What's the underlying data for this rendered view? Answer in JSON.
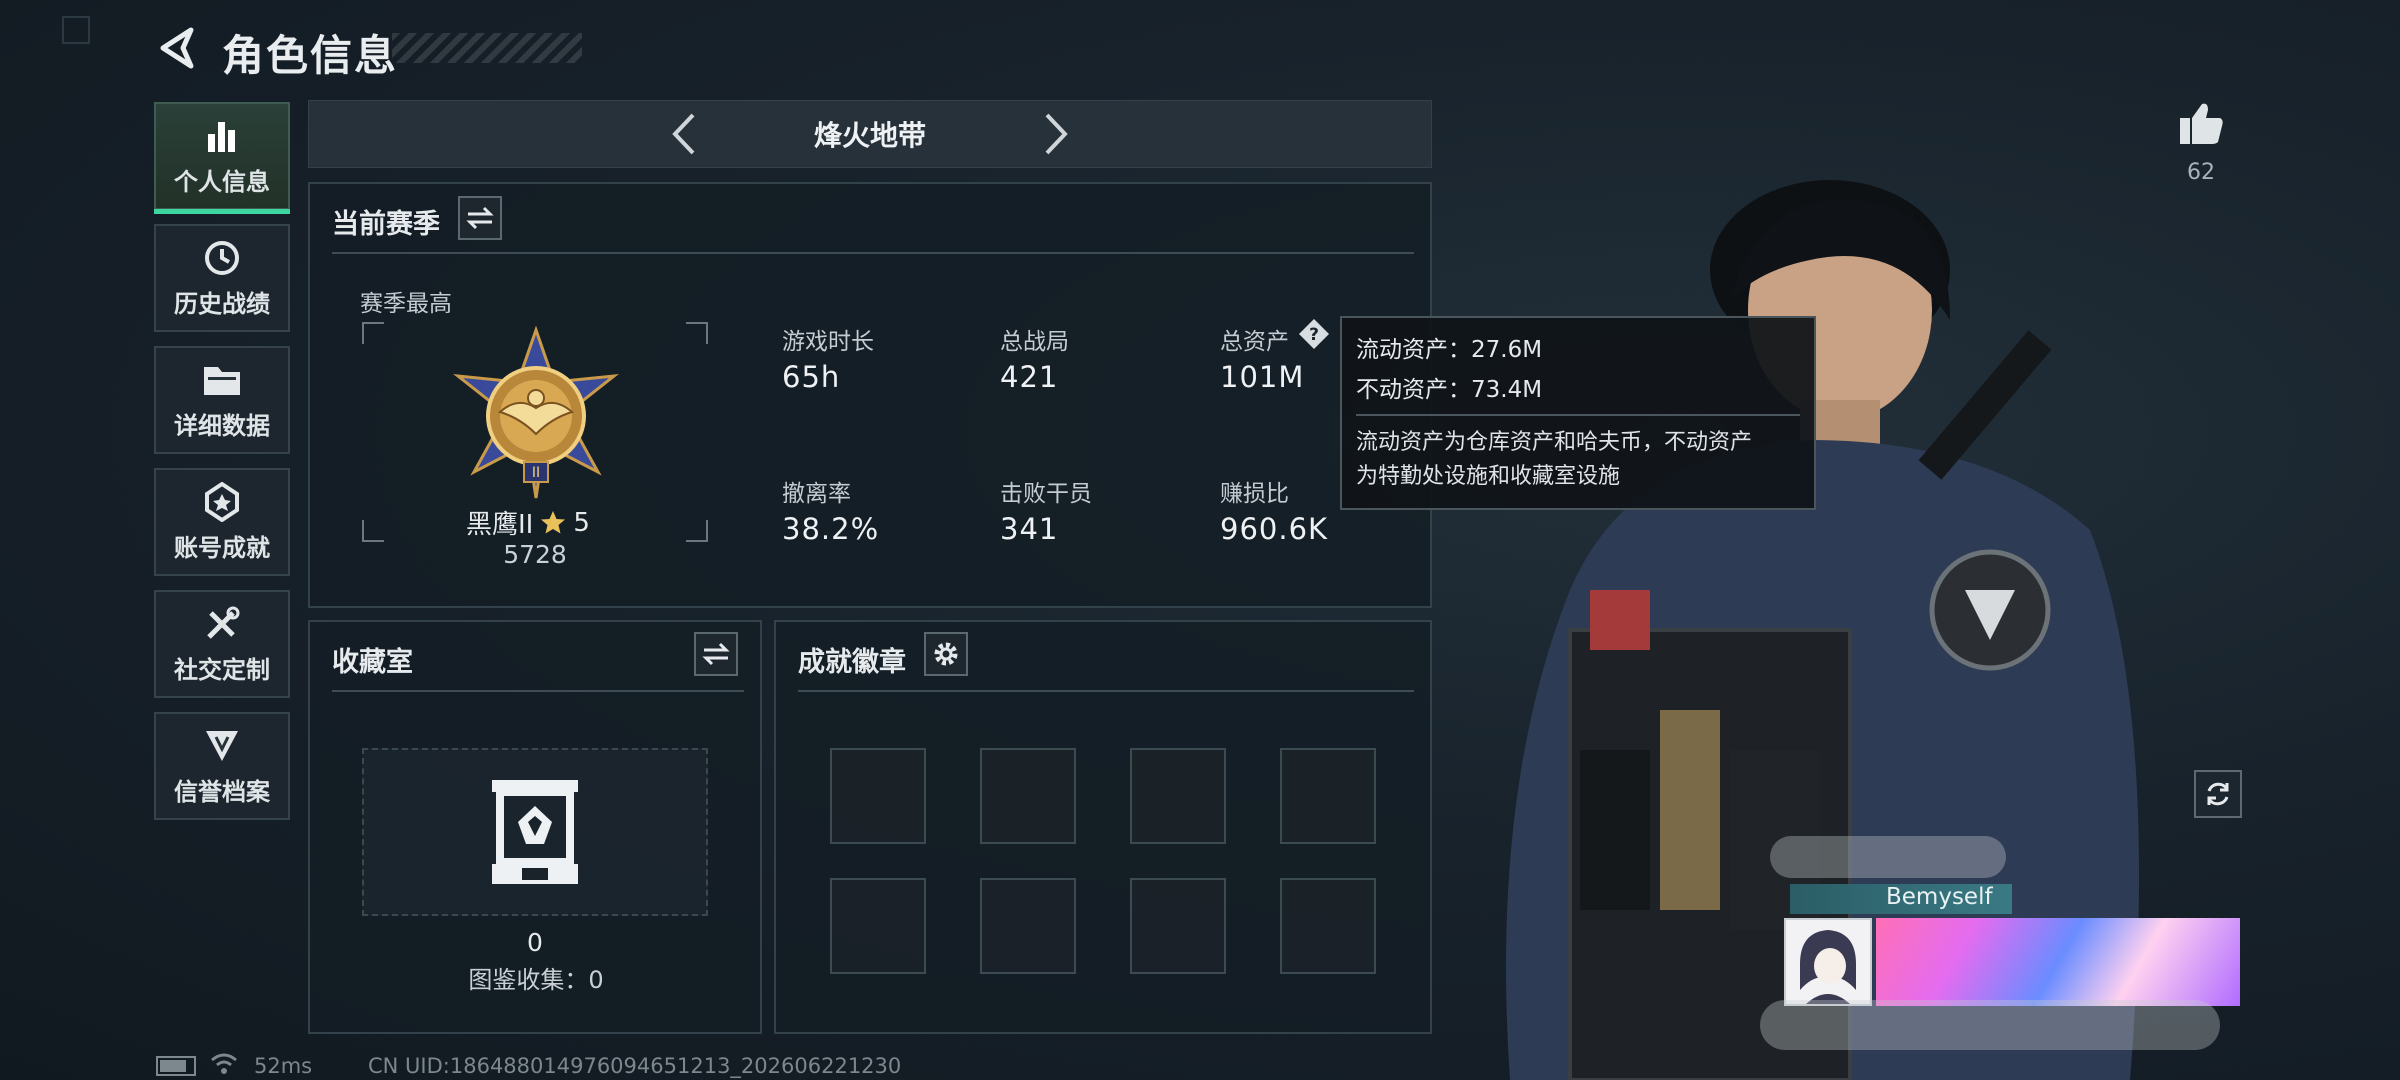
{
  "header": {
    "title": "角色信息"
  },
  "sidebar": {
    "items": [
      {
        "label": "个人信息",
        "icon": "bar-chart-icon",
        "active": true
      },
      {
        "label": "历史战绩",
        "icon": "history-icon"
      },
      {
        "label": "详细数据",
        "icon": "folder-icon"
      },
      {
        "label": "账号成就",
        "icon": "achievement-icon"
      },
      {
        "label": "社交定制",
        "icon": "tools-icon"
      },
      {
        "label": "信誉档案",
        "icon": "credit-icon"
      }
    ]
  },
  "mode_selector": {
    "title": "烽火地带"
  },
  "season": {
    "title": "当前赛季",
    "best_label": "赛季最高",
    "rank_name": "黑鹰II",
    "rank_stars": "5",
    "rank_score": "5728",
    "stats": [
      {
        "label": "游戏时长",
        "value": "65h"
      },
      {
        "label": "总战局",
        "value": "421"
      },
      {
        "label": "总资产",
        "value": "101M"
      },
      {
        "label": "撤离率",
        "value": "38.2%"
      },
      {
        "label": "击败干员",
        "value": "341"
      },
      {
        "label": "赚损比",
        "value": "960.6K"
      }
    ]
  },
  "tooltip": {
    "liquid": "流动资产：27.6M",
    "fixed": "不动资产：73.4M",
    "note_line1": "流动资产为仓库资产和哈夫币，不动资产",
    "note_line2": "为特勤处设施和收藏室设施"
  },
  "collection": {
    "title": "收藏室",
    "count": "0",
    "codex": "图鉴收集：0"
  },
  "achievements": {
    "title": "成就徽章"
  },
  "right": {
    "likes": "62",
    "player_name": "Bemyself"
  },
  "footer": {
    "ping": "52ms",
    "uid": "CN UID:1864880149760946512​13_202606221230"
  },
  "colors": {
    "accent": "#3ed6a0",
    "panel": "#141d24",
    "border": "#33424a"
  }
}
